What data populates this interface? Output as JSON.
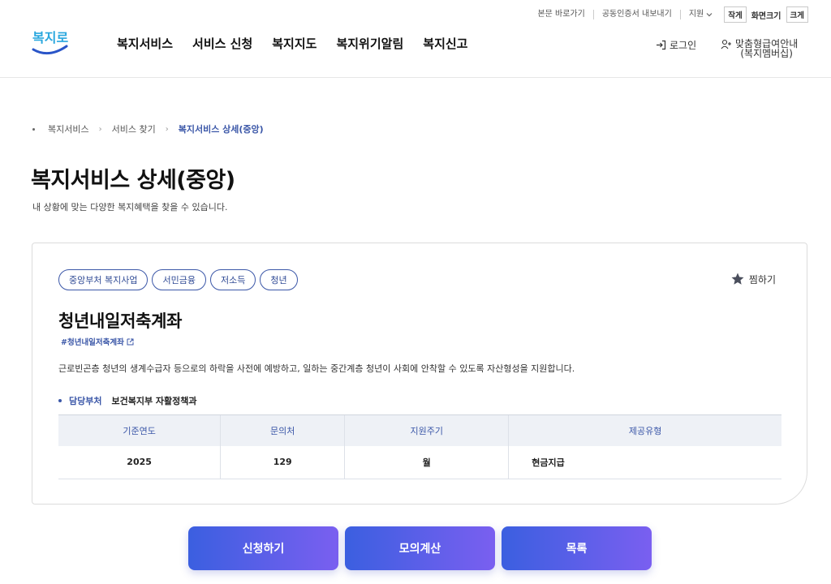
{
  "utility": {
    "skip": "본문 바로가기",
    "cert": "공동인증서 내보내기",
    "support": "지원",
    "size_small": "작게",
    "size_label": "화면크기",
    "size_large": "크게"
  },
  "logo": {
    "text": "복지로"
  },
  "gnb": [
    "복지서비스",
    "서비스 신청",
    "복지지도",
    "복지위기알림",
    "복지신고"
  ],
  "login": {
    "label": "로그인"
  },
  "member": {
    "line1": "맞춤형급여안내",
    "line2": "(복지멤버십)"
  },
  "breadcrumb": {
    "home": "복지서비스",
    "level2": "서비스 찾기",
    "current": "복지서비스 상세(중앙)"
  },
  "page": {
    "title": "복지서비스 상세(중앙)",
    "subtitle": "내 상황에 맞는 다양한 복지혜택을 찾을 수 있습니다."
  },
  "service": {
    "tags": [
      "중앙부처 복지사업",
      "서민금융",
      "저소득",
      "청년"
    ],
    "favorite": "찜하기",
    "title": "청년내일저축계좌",
    "hashtag": "#청년내일저축계좌",
    "description": "근로빈곤층 청년의 생계수급자 등으로의 하락을 사전에 예방하고, 일하는 중간계층 청년이 사회에 안착할 수 있도록 자산형성을 지원합니다.",
    "dept_label": "담당부처",
    "dept_value": "보건복지부 자활정책과",
    "table": {
      "headers": [
        "기준연도",
        "문의처",
        "지원주기",
        "제공유형"
      ],
      "row": [
        "2025",
        "129",
        "월",
        "현금지급"
      ]
    }
  },
  "buttons": {
    "apply": "신청하기",
    "calc": "모의계산",
    "list": "목록"
  },
  "colors": {
    "primary": "#3b57a8",
    "button_start": "#3b5fe0",
    "button_end": "#7a5ff0",
    "table_header_bg": "#eef1f6"
  }
}
